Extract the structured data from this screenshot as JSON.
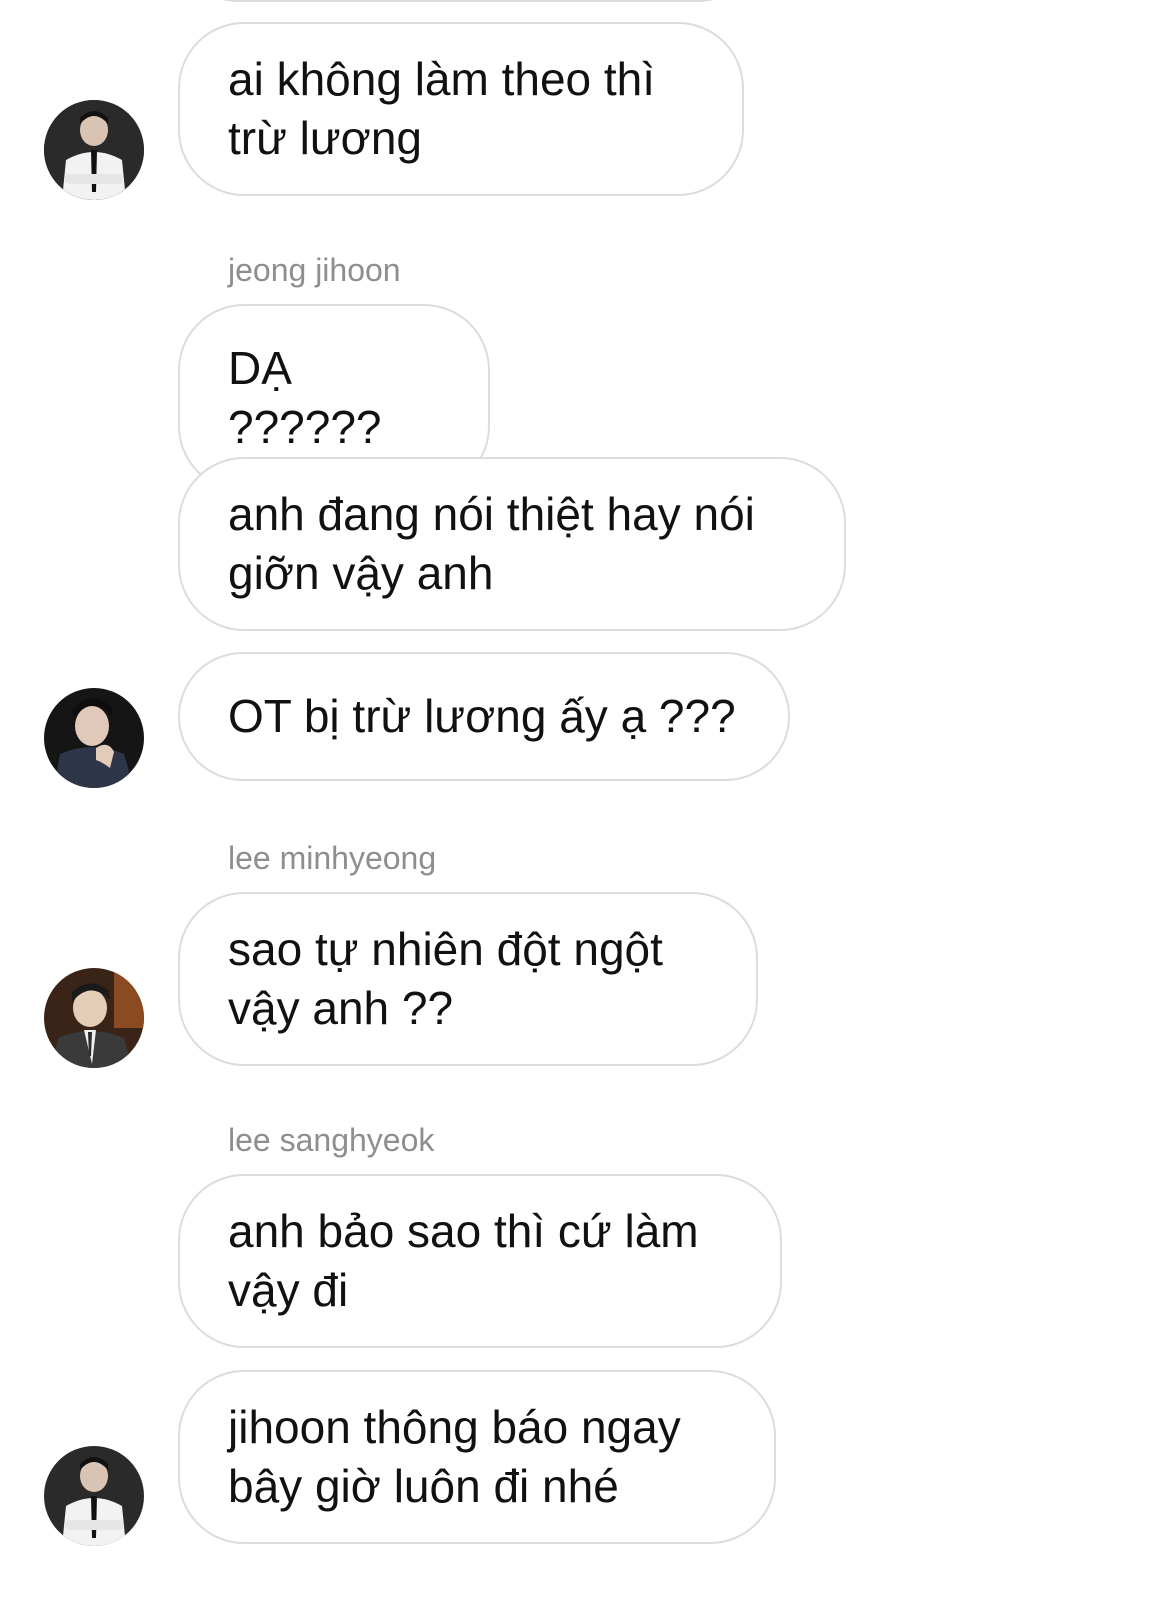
{
  "conversation": {
    "messages": [
      {
        "text": "ai không làm theo thì\ntrừ lương"
      },
      {
        "sender": "jeong jihoon"
      },
      {
        "text": "DẠ ??????"
      },
      {
        "text": "anh đang nói thiệt hay nói\ngiỡn vậy anh"
      },
      {
        "text": "OT bị trừ lương ấy ạ ???"
      },
      {
        "sender": "lee minhyeong"
      },
      {
        "text": "sao tự nhiên đột ngột\nvậy anh ??"
      },
      {
        "sender": "lee sanghyeok"
      },
      {
        "text": "anh bảo sao thì cứ làm\nvậy đi"
      },
      {
        "text": "jihoon thông báo ngay\nbây giờ luôn đi nhé"
      }
    ]
  },
  "avatars": [
    {
      "icon": "avatar-sanghyeok",
      "name": "lee sanghyeok"
    },
    {
      "icon": "avatar-jihoon",
      "name": "jeong jihoon"
    },
    {
      "icon": "avatar-minhyeong",
      "name": "lee minhyeong"
    },
    {
      "icon": "avatar-sanghyeok",
      "name": "lee sanghyeok"
    }
  ],
  "colors": {
    "bubble_border": "#dcdcdc",
    "sender_text": "#8e8e8e",
    "message_text": "#111111"
  }
}
